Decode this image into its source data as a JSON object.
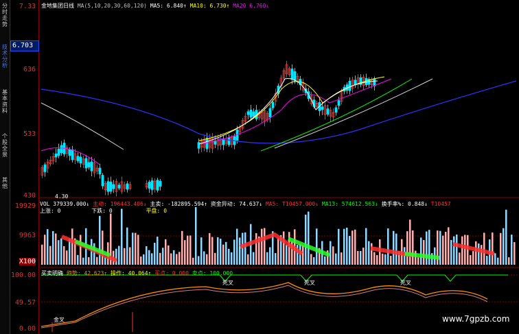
{
  "side_tabs": [
    {
      "label": "分时走势",
      "active": false
    },
    {
      "label": "技术分析",
      "active": true
    },
    {
      "label": "基本资料",
      "active": false
    },
    {
      "label": "个股全景",
      "active": false
    },
    {
      "label": "其他",
      "active": false
    }
  ],
  "price_axis": {
    "labels": [
      "7.33",
      "636",
      "533",
      "430"
    ],
    "current_price": "6.703",
    "low_marker": "4.30"
  },
  "volume_axis": {
    "labels": [
      "19929",
      "9963",
      "X100"
    ]
  },
  "indicator_axis": {
    "labels": [
      "100.00",
      "49.57",
      "0.00"
    ]
  },
  "main_header": {
    "title": "金地集团日线",
    "ma_params": "MA(5,10,20,30,60,120)",
    "ma5": "MA5: 6.840↑",
    "ma10": "MA10: 6.730↑",
    "ma20": "MA20  6.760↓"
  },
  "volume_header": {
    "vol": "VOL 379339.000↓",
    "main_label": "主动: 196443.406↓",
    "main_buy": "主卖: -182895.594↑",
    "flow": "资金异动: 74.637↓",
    "ma5": "MA5: T10457.000↓",
    "ma13": "MA13: 574612.563↓",
    "turnover": "换手率%: 0.848↓",
    "ma_extra": "T10457"
  },
  "volume_sub": {
    "up": "上涨: 0",
    "down": "下跌: 0",
    "flat": "平盘: 0"
  },
  "indicator_header": {
    "name": "买卖明确",
    "trend": "趋势: 42.623↑",
    "operate": "操作: 40.064↑",
    "buy": "买点: 0.000",
    "sell": "卖点: 100.000"
  },
  "annotations": {
    "golden_cross": "金叉",
    "dead_cross": "死叉"
  },
  "watermark": "www.7gpzb.com",
  "colors": {
    "up": "#ff3030",
    "down": "#00e5ff",
    "ma5": "#ffffff",
    "ma10": "#ffff00",
    "ma20": "#ff00ff",
    "ma60": "#00ff00",
    "ma120": "#3030ff",
    "trend": "#ff8c00",
    "operate": "#d08080",
    "signal": "#00ff00"
  }
}
